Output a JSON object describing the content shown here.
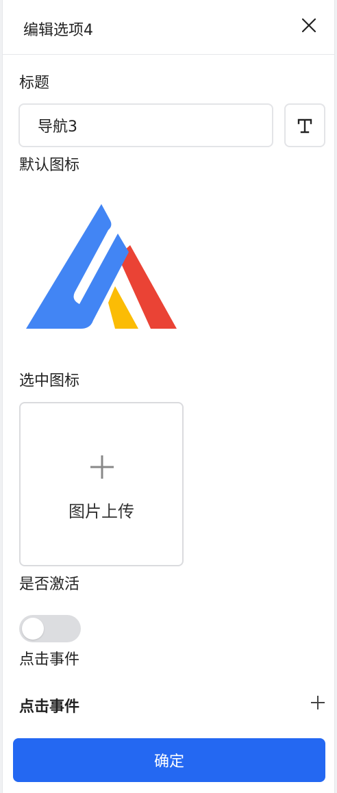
{
  "dialog": {
    "title": "编辑选项4",
    "close_icon": "close-icon"
  },
  "form": {
    "title_label": "标题",
    "title_value": "导航3",
    "font_icon": "text-format-icon",
    "default_icon_label": "默认图标",
    "default_icon_image": "triangle-logo",
    "selected_icon_label": "选中图标",
    "upload_text": "图片上传",
    "upload_icon": "plus-icon",
    "active_label": "是否激活",
    "active_value": false,
    "click_event_label": "点击事件",
    "click_event_heading": "点击事件",
    "add_event_icon": "plus-icon"
  },
  "footer": {
    "confirm_label": "确定"
  },
  "colors": {
    "primary": "#2468f2",
    "logo_blue": "#4285f4",
    "logo_red": "#ea4335",
    "logo_yellow": "#fbbc05",
    "toggle_off": "#dcdde0"
  }
}
